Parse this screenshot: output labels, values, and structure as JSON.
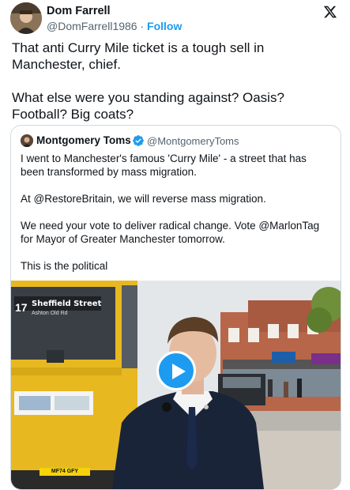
{
  "tweet": {
    "author_name": "Dom Farrell",
    "author_handle": "@DomFarrell1986",
    "separator": "·",
    "follow_label": "Follow",
    "brand_icon": "x-logo-icon",
    "paragraphs": [
      "That anti Curry Mile ticket is a tough sell in Manchester, chief.",
      "What else were you standing against? Oasis? Football? Big coats?"
    ]
  },
  "quote": {
    "author_name": "Montgomery Toms",
    "author_handle": "@MontgomeryToms",
    "verified_icon": "verified-badge-icon",
    "paragraphs": [
      "I went to Manchester's famous 'Curry Mile' - a street that has been transformed by mass migration.",
      "At @RestoreBritain, we will reverse mass migration.",
      "We need your vote to deliver radical change. Vote @MarlonTag for Mayor of Greater Manchester tomorrow.",
      "This is the political"
    ],
    "video": {
      "play_icon": "play-icon",
      "bus_number": "17",
      "bus_destination": "Sheffield Street",
      "bus_sub": "Ashton Old Rd",
      "plate": "MF74 GFY"
    }
  },
  "colors": {
    "accent": "#1d9bf0",
    "text": "#0f1419",
    "secondary": "#536471",
    "border": "#cfd9de",
    "bus_yellow": "#e8b820"
  }
}
